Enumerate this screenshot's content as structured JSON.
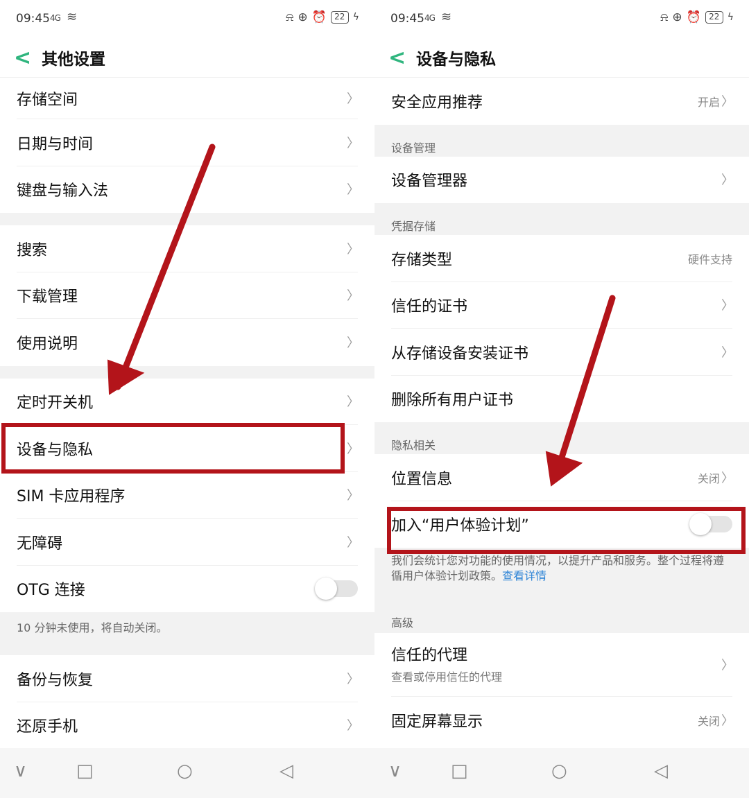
{
  "status_bar": {
    "time": "09:45",
    "network": "4G",
    "battery": "22"
  },
  "left": {
    "title": "其他设置",
    "rows_a": [
      {
        "label": "存储空间"
      },
      {
        "label": "日期与时间"
      },
      {
        "label": "键盘与输入法"
      }
    ],
    "rows_b": [
      {
        "label": "搜索"
      },
      {
        "label": "下载管理"
      },
      {
        "label": "使用说明"
      }
    ],
    "rows_c": [
      {
        "label": "定时开关机"
      },
      {
        "label": "设备与隐私"
      },
      {
        "label": "SIM 卡应用程序"
      },
      {
        "label": "无障碍"
      },
      {
        "label": "OTG 连接"
      }
    ],
    "otg_note": "10 分钟未使用，将自动关闭。",
    "rows_d": [
      {
        "label": "备份与恢复"
      },
      {
        "label": "还原手机"
      }
    ]
  },
  "right": {
    "title": "设备与隐私",
    "safe_apps": {
      "label": "安全应用推荐",
      "value": "开启"
    },
    "section_device": "设备管理",
    "device_admin": {
      "label": "设备管理器"
    },
    "section_credential": "凭据存储",
    "storage_type": {
      "label": "存储类型",
      "value": "硬件支持"
    },
    "trusted_certs": {
      "label": "信任的证书"
    },
    "install_certs": {
      "label": "从存储设备安装证书"
    },
    "remove_certs": {
      "label": "删除所有用户证书"
    },
    "section_privacy": "隐私相关",
    "location": {
      "label": "位置信息",
      "value": "关闭"
    },
    "ux_plan": {
      "label": "加入“用户体验计划”",
      "enabled": false
    },
    "ux_note": "我们会统计您对功能的使用情况，以提升产品和服务。整个过程将遵循用户体验计划政策。",
    "ux_link": "查看详情",
    "section_advanced": "高级",
    "trust_agents": {
      "label": "信任的代理",
      "sub": "查看或停用信任的代理"
    },
    "screen_pin": {
      "label": "固定屏幕显示",
      "value": "关闭"
    }
  },
  "glyphs": {
    "back": "<",
    "chevron": "〉",
    "nav_down": "∨",
    "nav_square": "□",
    "nav_circle": "○",
    "nav_back": "◁",
    "wifi": "≋",
    "bolt": "ϟ"
  },
  "annotation_color": "#b3141a",
  "accent_color": "#2fb57e"
}
